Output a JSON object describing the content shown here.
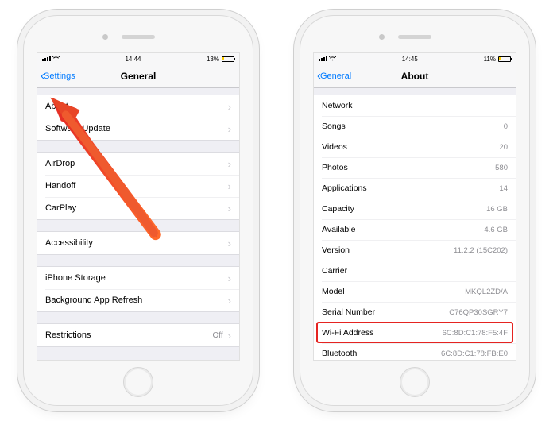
{
  "left": {
    "status": {
      "time": "14:44",
      "battery_pct": "13%"
    },
    "nav": {
      "back": "Settings",
      "title": "General"
    },
    "rows": {
      "about": "About",
      "software_update": "Software Update",
      "airdrop": "AirDrop",
      "handoff": "Handoff",
      "carplay": "CarPlay",
      "accessibility": "Accessibility",
      "iphone_storage": "iPhone Storage",
      "background_app_refresh": "Background App Refresh",
      "restrictions": "Restrictions",
      "restrictions_val": "Off"
    }
  },
  "right": {
    "status": {
      "time": "14:45",
      "battery_pct": "11%"
    },
    "nav": {
      "back": "General",
      "title": "About"
    },
    "rows": {
      "network": {
        "label": "Network",
        "val": ""
      },
      "songs": {
        "label": "Songs",
        "val": "0"
      },
      "videos": {
        "label": "Videos",
        "val": "20"
      },
      "photos": {
        "label": "Photos",
        "val": "580"
      },
      "applications": {
        "label": "Applications",
        "val": "14"
      },
      "capacity": {
        "label": "Capacity",
        "val": "16 GB"
      },
      "available": {
        "label": "Available",
        "val": "4.6 GB"
      },
      "version": {
        "label": "Version",
        "val": "11.2.2 (15C202)"
      },
      "carrier": {
        "label": "Carrier",
        "val": ""
      },
      "model": {
        "label": "Model",
        "val": "MKQL2ZD/A"
      },
      "serial": {
        "label": "Serial Number",
        "val": "C76QP30SGRY7"
      },
      "wifi": {
        "label": "Wi-Fi Address",
        "val": "6C:8D:C1:78:F5:4F"
      },
      "bluetooth": {
        "label": "Bluetooth",
        "val": "6C:8D:C1:78:FB:E0"
      }
    }
  }
}
